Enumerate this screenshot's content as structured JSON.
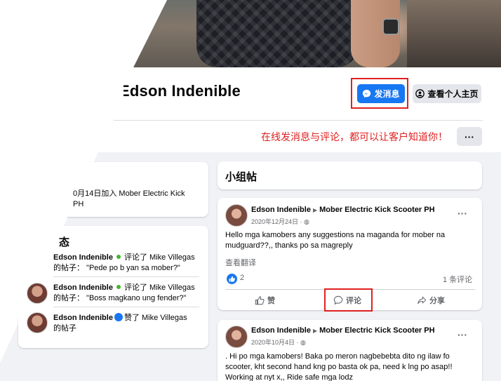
{
  "profile": {
    "name": "Edson Indenible",
    "message_button": "发消息",
    "view_profile_button": "查看个人主页",
    "more_button": "···"
  },
  "annotation": "在线发消息与评论，都可以让客户知道你！",
  "left": {
    "joined_line1": "0月14日加入 Mober Electric Kick",
    "joined_line2": "PH",
    "activity_title": "态",
    "activities": [
      {
        "actor": "Edson Indenible",
        "verb": "评论了 Mike Villegas",
        "line2": "的帖子： \"Pede po b yan sa mober?\""
      },
      {
        "actor": "Edson Indenible",
        "verb": "评论了 Mike Villegas",
        "line2": "的帖子： \"Boss magkano ung fender?\""
      },
      {
        "actor": "Edson Indenible",
        "verb": "赞了 Mike Villegas",
        "line2": "的帖子"
      }
    ]
  },
  "group_posts": {
    "title": "小组帖",
    "posts": [
      {
        "author": "Edson Indenible",
        "group": "Mober Electric Kick Scooter PH",
        "date": "2020年12月24日 · ",
        "text_line1": "Hello mga kamobers any suggestions na maganda for mober na",
        "text_line2": "mudguard??,, thanks po sa magreply",
        "see_translation": "查看翻译",
        "likes": "2",
        "comments": "1 条评论",
        "like_action": "赞",
        "comment_action": "评论",
        "share_action": "分享"
      },
      {
        "author": "Edson Indenible",
        "group": "Mober Electric Kick Scooter PH",
        "date": "2020年10月4日 · ",
        "text_line1": ". Hi po mga kamobers! Baka po meron nagbebebta dito ng ilaw fo",
        "text_line2": "scooter, kht  second hand kng po basta ok pa, need k lng po asap!!",
        "text_line3": "Working at nyt x,, Ride safe mga lodz"
      }
    ]
  },
  "colors": {
    "brand_blue": "#1877f2",
    "annotation_red": "#e02020",
    "body_grey": "#f0f2f5"
  }
}
